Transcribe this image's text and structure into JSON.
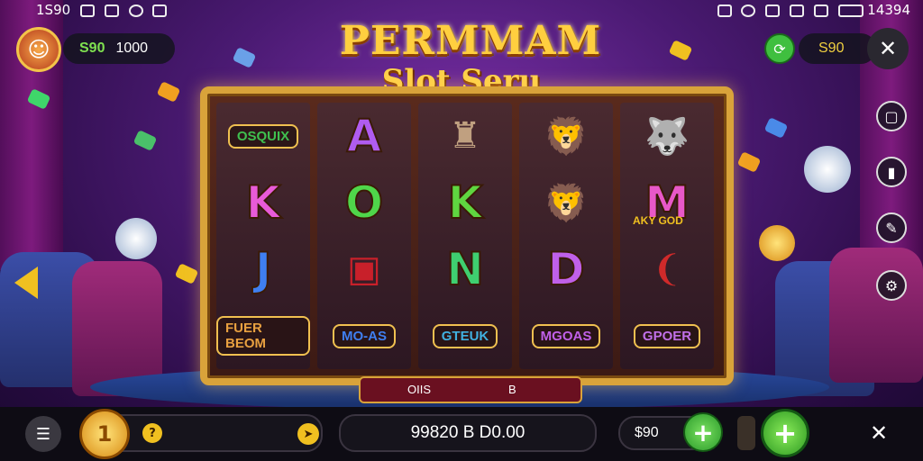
{
  "status_bar": {
    "left_text": "1S90",
    "right_text": "14394"
  },
  "header": {
    "balance_label": "S90",
    "balance_value": "1000",
    "title_line1": "PERMMAM",
    "title_line2": "Slot Seru",
    "right_balance": "S90"
  },
  "reels": [
    [
      {
        "label": "OSQUIX",
        "kind": "label",
        "color": "#3fbf4f"
      },
      {
        "text": "K",
        "kind": "letter",
        "color": "#e85bd8"
      },
      {
        "text": "J",
        "kind": "letter",
        "color": "#3f7ff0"
      },
      {
        "label": "FUER BEOM",
        "kind": "label",
        "color": "#e8a040"
      }
    ],
    [
      {
        "text": "A",
        "kind": "letter",
        "color": "#b05cf0"
      },
      {
        "text": "O",
        "kind": "letter",
        "color": "#4fd64a"
      },
      {
        "icon": "ruby-chest",
        "kind": "icon",
        "color": "#c8202a"
      },
      {
        "label": "MO-AS",
        "kind": "label",
        "color": "#3f7ff0"
      }
    ],
    [
      {
        "icon": "silver-cup",
        "kind": "icon",
        "color": "#c0a080"
      },
      {
        "text": "K",
        "kind": "letter",
        "color": "#5fd640"
      },
      {
        "text": "N",
        "kind": "letter",
        "color": "#3fcf70"
      },
      {
        "label": "GTEUK",
        "kind": "label",
        "color": "#40b0e0"
      }
    ],
    [
      {
        "icon": "lion",
        "kind": "icon",
        "color": "#f0902a"
      },
      {
        "icon": "lion",
        "kind": "icon",
        "color": "#e89a2a"
      },
      {
        "text": "D",
        "kind": "letter",
        "color": "#c060e8"
      },
      {
        "label": "MGOAS",
        "kind": "label",
        "color": "#c060e8"
      }
    ],
    [
      {
        "icon": "wolf",
        "kind": "icon",
        "color": "#8a9ac0"
      },
      {
        "text": "M",
        "kind": "letter",
        "color": "#e858c8"
      },
      {
        "icon": "red-horn",
        "kind": "icon",
        "color": "#d02a2a"
      },
      {
        "label": "GPOER",
        "kind": "label",
        "color": "#c070e8"
      }
    ]
  ],
  "reel_overlays": {
    "row2_col5_label": "AKY GOD"
  },
  "info_bar": {
    "left": "OIIS",
    "right": "B"
  },
  "footer": {
    "total_bet": "99820 B D0.00",
    "bet_amount": "$90",
    "coin_glyph": "1"
  },
  "colors": {
    "gold": "#d9a33a",
    "green": "#3fbf3f",
    "dark": "#0e0c14"
  }
}
